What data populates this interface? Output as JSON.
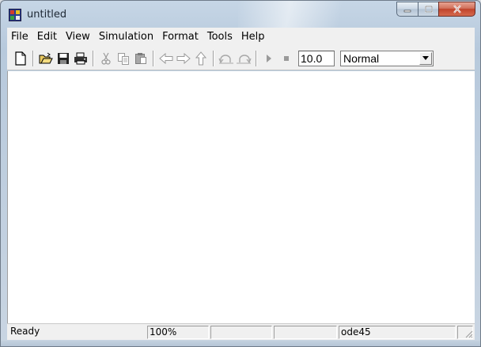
{
  "window": {
    "title": "untitled",
    "caption_buttons": [
      "minimize",
      "maximize",
      "close"
    ]
  },
  "menu": {
    "items": [
      "File",
      "Edit",
      "View",
      "Simulation",
      "Format",
      "Tools",
      "Help"
    ]
  },
  "toolbar": {
    "icons": [
      "new-icon",
      "open-icon",
      "save-icon",
      "print-icon",
      "cut-icon",
      "copy-icon",
      "paste-icon",
      "back-icon",
      "forward-icon",
      "up-icon",
      "undo-icon",
      "redo-icon",
      "start-simulation-icon",
      "stop-simulation-icon"
    ],
    "stop_time": "10.0",
    "simulation_mode": "Normal"
  },
  "status": {
    "state": "Ready",
    "zoom": "100%",
    "cell3": "",
    "cell4": "",
    "solver": "ode45",
    "cell6": ""
  },
  "colors": {
    "frame": "#c6d6e6",
    "close_button": "#c0432b",
    "canvas": "#ffffff",
    "chrome": "#f0f0f0"
  }
}
